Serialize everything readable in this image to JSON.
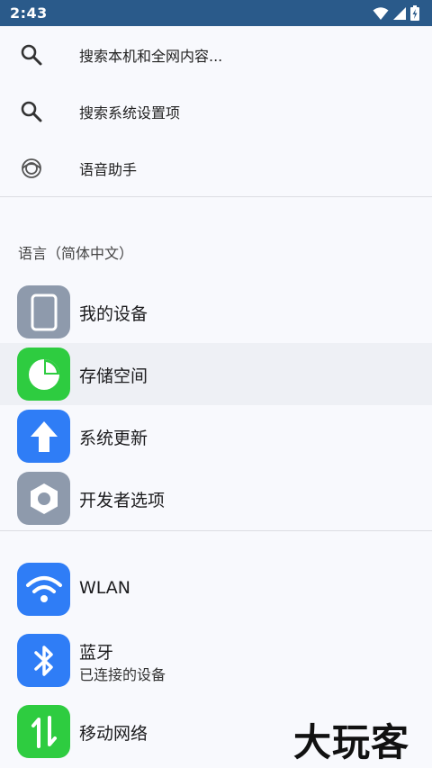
{
  "status_bar": {
    "time": "2:43"
  },
  "search": {
    "global_placeholder": "搜索本机和全网内容...",
    "settings_placeholder": "搜索系统设置项",
    "voice_assistant": "语音助手"
  },
  "section_label": "语言（简体中文）",
  "items": [
    {
      "label": "我的设备",
      "icon": "phone-icon",
      "color": "#8e9aac"
    },
    {
      "label": "存储空间",
      "icon": "pie-chart-icon",
      "color": "#2ecc40"
    },
    {
      "label": "系统更新",
      "icon": "arrow-up-icon",
      "color": "#2f7df6"
    },
    {
      "label": "开发者选项",
      "icon": "hexagon-icon",
      "color": "#8e9aac"
    },
    {
      "label": "WLAN",
      "icon": "wifi-icon",
      "color": "#2f7df6"
    },
    {
      "label": "蓝牙",
      "sublabel": "已连接的设备",
      "icon": "bluetooth-icon",
      "color": "#2f7df6"
    },
    {
      "label": "移动网络",
      "icon": "mobile-data-icon",
      "color": "#2ecc40"
    }
  ],
  "watermark": "大玩客"
}
